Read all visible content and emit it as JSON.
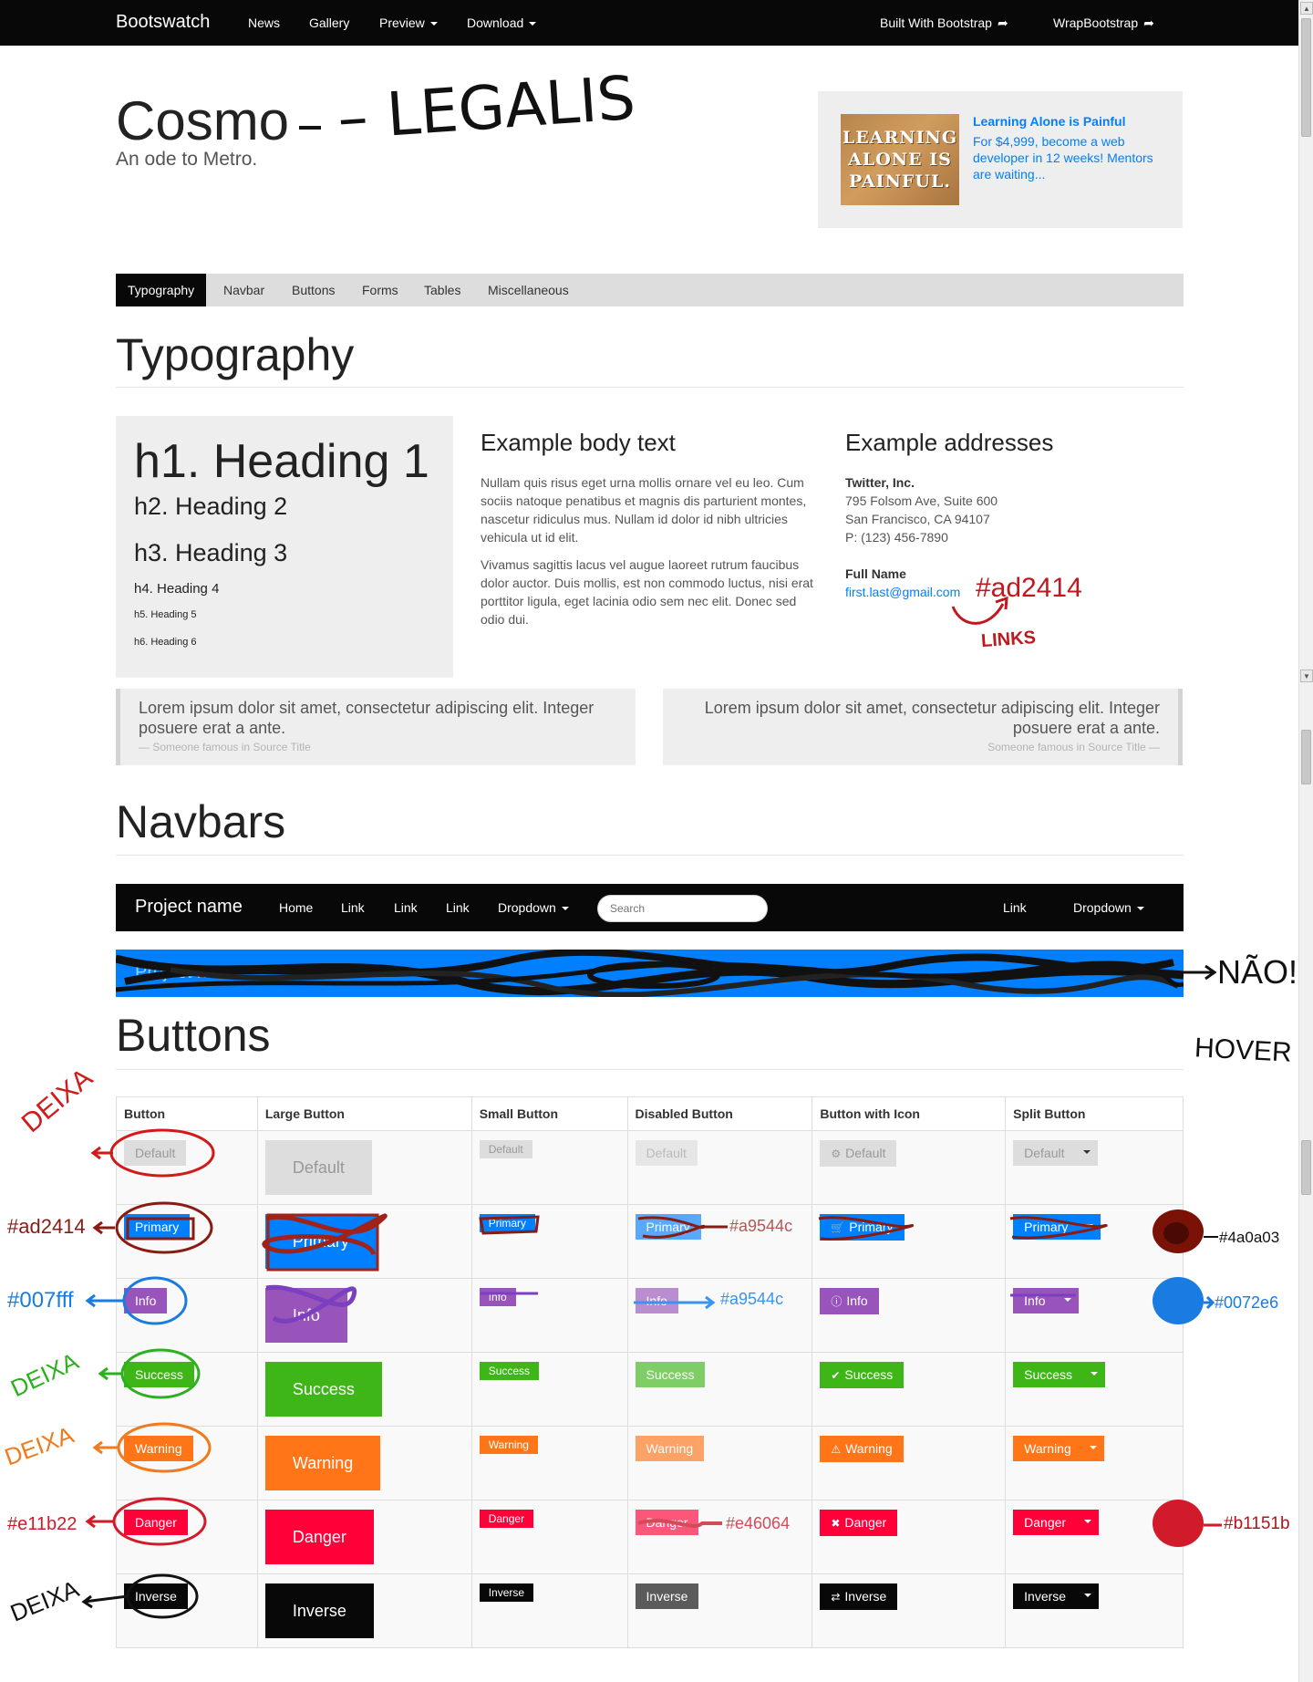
{
  "topnav": {
    "brand": "Bootswatch",
    "items": [
      "News",
      "Gallery",
      "Preview",
      "Download"
    ],
    "right_items": [
      "Built With Bootstrap",
      "WrapBootstrap"
    ]
  },
  "header": {
    "title": "Cosmo",
    "subtitle": "An ode to Metro."
  },
  "ad": {
    "image_text": "LEARNING ALONE IS PAINFUL.",
    "title": "Learning Alone is Painful",
    "text": "For $4,999, become a web developer in 12 weeks! Mentors are waiting..."
  },
  "tabs": [
    "Typography",
    "Navbar",
    "Buttons",
    "Forms",
    "Tables",
    "Miscellaneous"
  ],
  "typography": {
    "title": "Typography",
    "headings": [
      "h1. Heading 1",
      "h2. Heading 2",
      "h3. Heading 3",
      "h4. Heading 4",
      "h5. Heading 5",
      "h6. Heading 6"
    ],
    "body_title": "Example body text",
    "body_p1": "Nullam quis risus eget urna mollis ornare vel eu leo. Cum sociis natoque penatibus et magnis dis parturient montes, nascetur ridiculus mus. Nullam id dolor id nibh ultricies vehicula ut id elit.",
    "body_p2": "Vivamus sagittis lacus vel augue laoreet rutrum faucibus dolor auctor. Duis mollis, est non commodo luctus, nisi erat porttitor ligula, eget lacinia odio sem nec elit. Donec sed odio dui.",
    "addr_title": "Example addresses",
    "company": "Twitter, Inc.",
    "street": "795 Folsom Ave, Suite 600",
    "city": "San Francisco, CA 94107",
    "phone_label": "P:",
    "phone": "(123) 456-7890",
    "name": "Full Name",
    "email": "first.last@gmail.com",
    "quote_text": "Lorem ipsum dolor sit amet, consectetur adipiscing elit. Integer posuere erat a ante.",
    "quote_left_source": "— Someone famous in Source Title",
    "quote_right_source": "Someone famous in Source Title —"
  },
  "navbars": {
    "title": "Navbars",
    "brand": "Project name",
    "items": [
      "Home",
      "Link",
      "Link",
      "Link",
      "Dropdown"
    ],
    "search_placeholder": "Search",
    "right_items": [
      "Link",
      "Dropdown"
    ]
  },
  "buttons": {
    "title": "Buttons",
    "columns": [
      "Button",
      "Large Button",
      "Small Button",
      "Disabled Button",
      "Button with Icon",
      "Split Button"
    ],
    "labels": [
      "Default",
      "Primary",
      "Info",
      "Success",
      "Warning",
      "Danger",
      "Inverse"
    ]
  },
  "annotations": {
    "title_scribble": "– LEGALIS",
    "link_color": "#ad2414",
    "link_note": "LINKS",
    "navbar_note": "NÃO!",
    "hover_note": "HOVER",
    "keep": "DEIXA",
    "primary_color": "#ad2414",
    "info_color": "#007fff",
    "danger_color": "#e11b22",
    "disabled_primary": "#a9544c",
    "disabled_info": "#a9544c",
    "disabled_danger": "#e46064",
    "split_primary": "#4a0a03",
    "split_info": "#0072e6",
    "split_danger": "#b1151b"
  },
  "colors": {
    "navbar_bg": "#080808",
    "primary": "#007fff",
    "info": "#9954bb",
    "success": "#3fb618",
    "warning": "#ff7518",
    "danger": "#ff0039",
    "inverse": "#080808",
    "default": "#dddddd"
  }
}
